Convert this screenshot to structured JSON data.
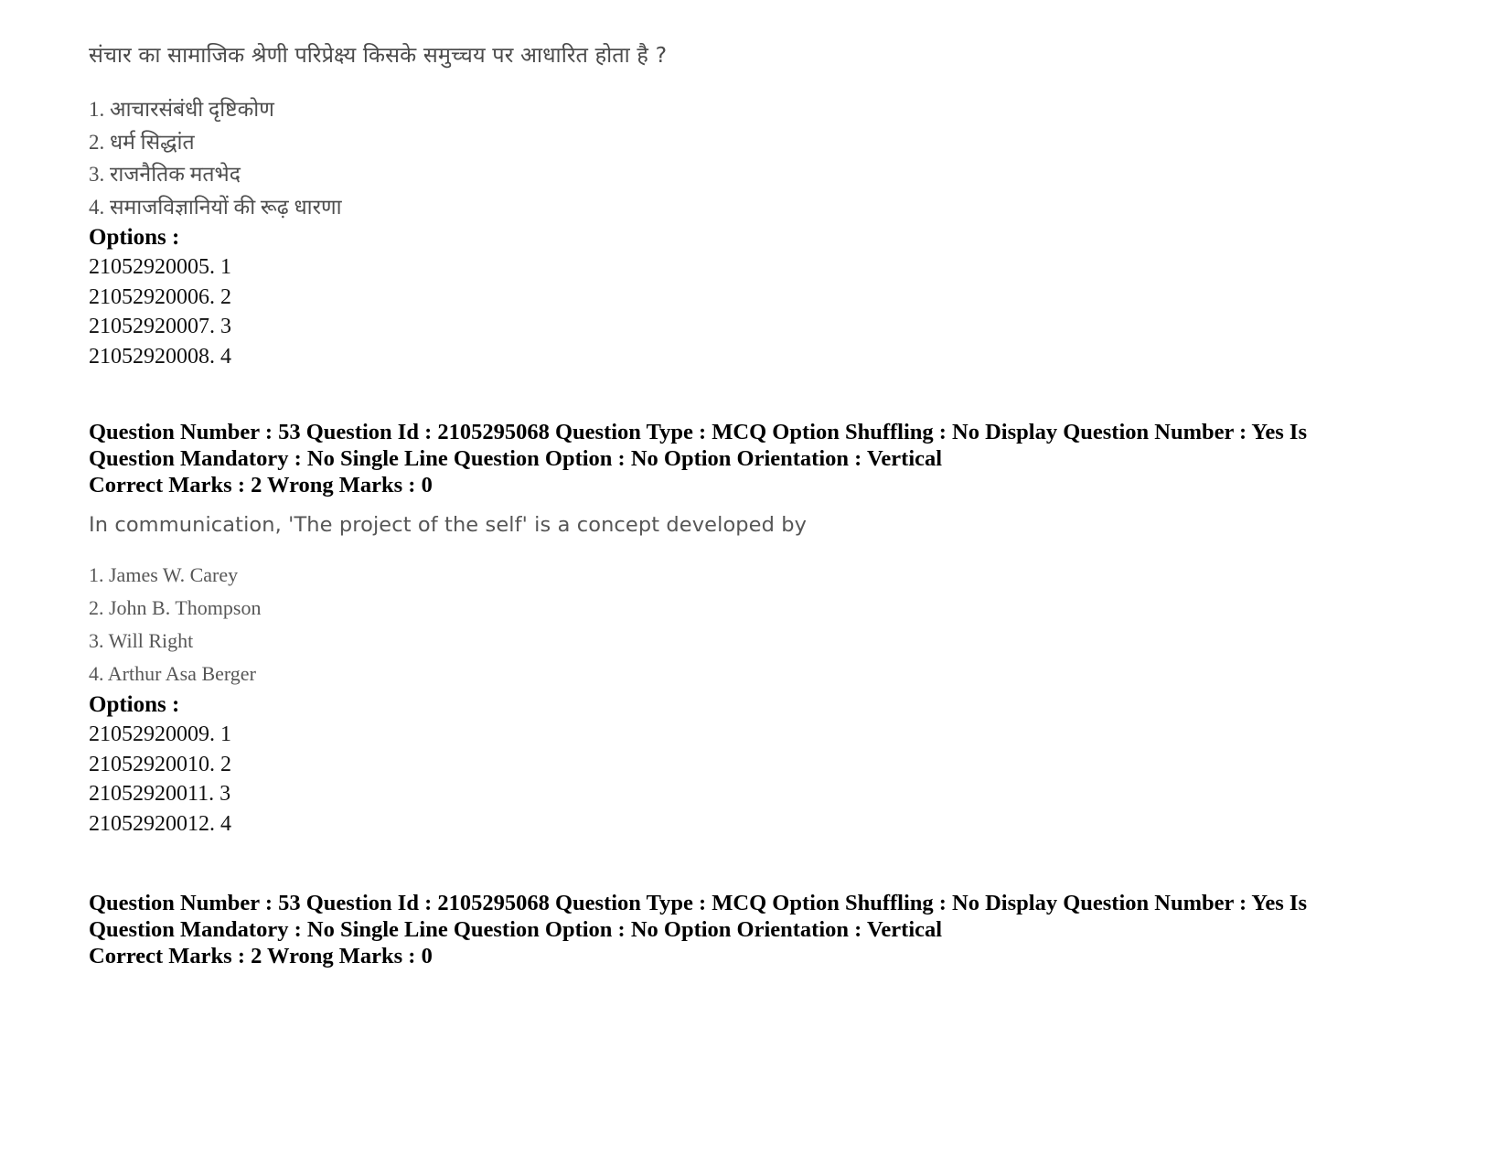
{
  "document": {
    "type": "exam-answer-key-page"
  },
  "blocks": {
    "hindi_question": {
      "text": "संचार का सामाजिक श्रेणी परिप्रेक्ष्य किसके समुच्चय पर आधारित होता है ?",
      "options": [
        "1. आचारसंबंधी दृष्टिकोण",
        "2. धर्म सिद्धांत",
        "3. राजनैतिक मतभेद",
        "4. समाजविज्ञानियों की रूढ़ धारणा"
      ],
      "options_label": "Options :",
      "option_ids": [
        "21052920005. 1",
        "21052920006. 2",
        "21052920007. 3",
        "21052920008. 4"
      ]
    },
    "metadata_1": {
      "line1": "Question Number : 53 Question Id : 2105295068 Question Type : MCQ Option Shuffling : No Display Question Number : Yes Is",
      "line2": "Question Mandatory : No Single Line Question Option : No Option Orientation : Vertical",
      "line3": "Correct Marks : 2 Wrong Marks : 0"
    },
    "english_question": {
      "text": "In communication, 'The project of the self' is a concept developed by",
      "options": [
        "1. James W. Carey",
        "2. John B. Thompson",
        "3. Will Right",
        "4. Arthur Asa Berger"
      ],
      "options_label": "Options :",
      "option_ids": [
        "21052920009. 1",
        "21052920010. 2",
        "21052920011. 3",
        "21052920012. 4"
      ]
    },
    "metadata_2": {
      "line1": "Question Number : 53 Question Id : 2105295068 Question Type : MCQ Option Shuffling : No Display Question Number : Yes Is",
      "line2": "Question Mandatory : No Single Line Question Option : No Option Orientation : Vertical",
      "line3": "Correct Marks : 2 Wrong Marks : 0"
    }
  }
}
